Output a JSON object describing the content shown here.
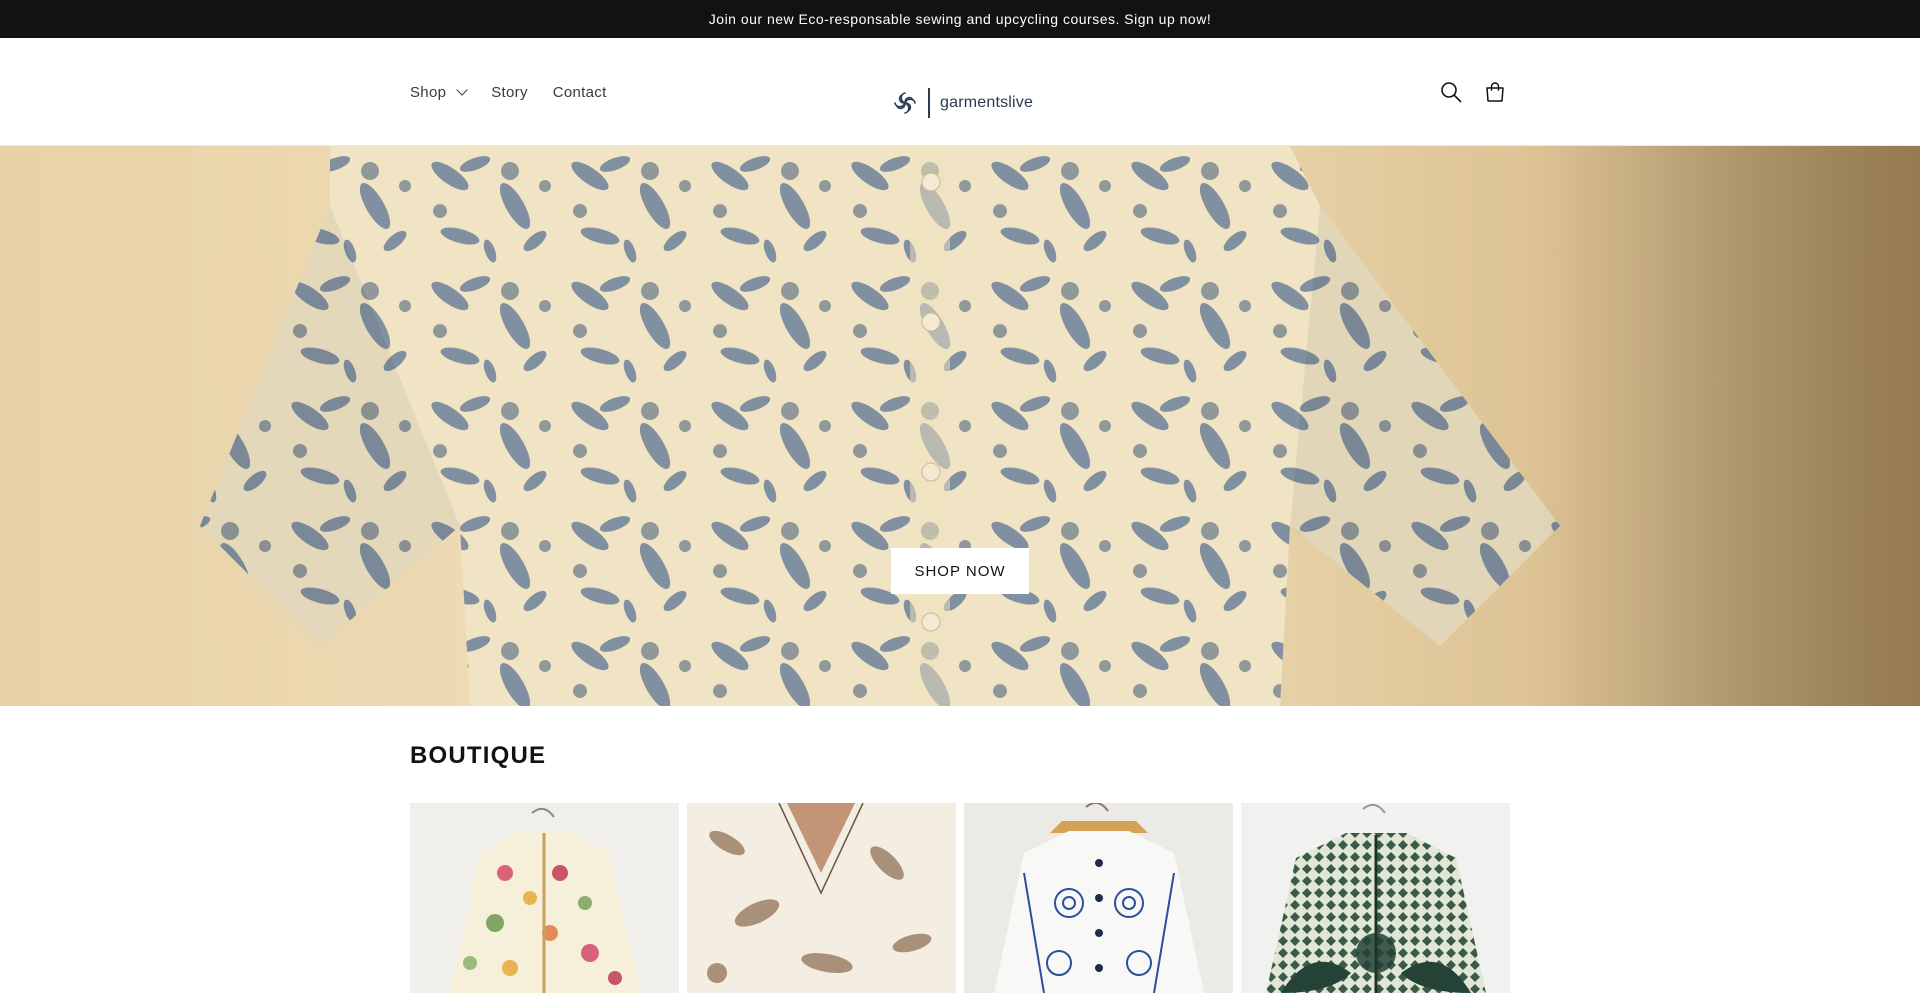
{
  "announcement": {
    "text": "Join our new Eco-responsable sewing and upcycling courses. Sign up now!"
  },
  "header": {
    "nav": [
      {
        "label": "Shop",
        "has_dropdown": true
      },
      {
        "label": "Story"
      },
      {
        "label": "Contact"
      }
    ],
    "logo": {
      "text": "garmentslive",
      "icon": "swirl-logo-icon"
    },
    "icons": [
      "search-icon",
      "cart-icon"
    ]
  },
  "hero": {
    "cta_label": "SHOP NOW"
  },
  "boutique": {
    "title": "BOUTIQUE",
    "products": [
      {
        "image": "floral-embroidered-jacket"
      },
      {
        "image": "brown-floral-blouse"
      },
      {
        "image": "blue-white-embroidered-jacket"
      },
      {
        "image": "green-patterned-jacket"
      }
    ]
  },
  "colors": {
    "announcement_bg": "#121212",
    "hero_bg": "#ecd7ae",
    "text": "#121212",
    "logo": "#2a3a52"
  }
}
